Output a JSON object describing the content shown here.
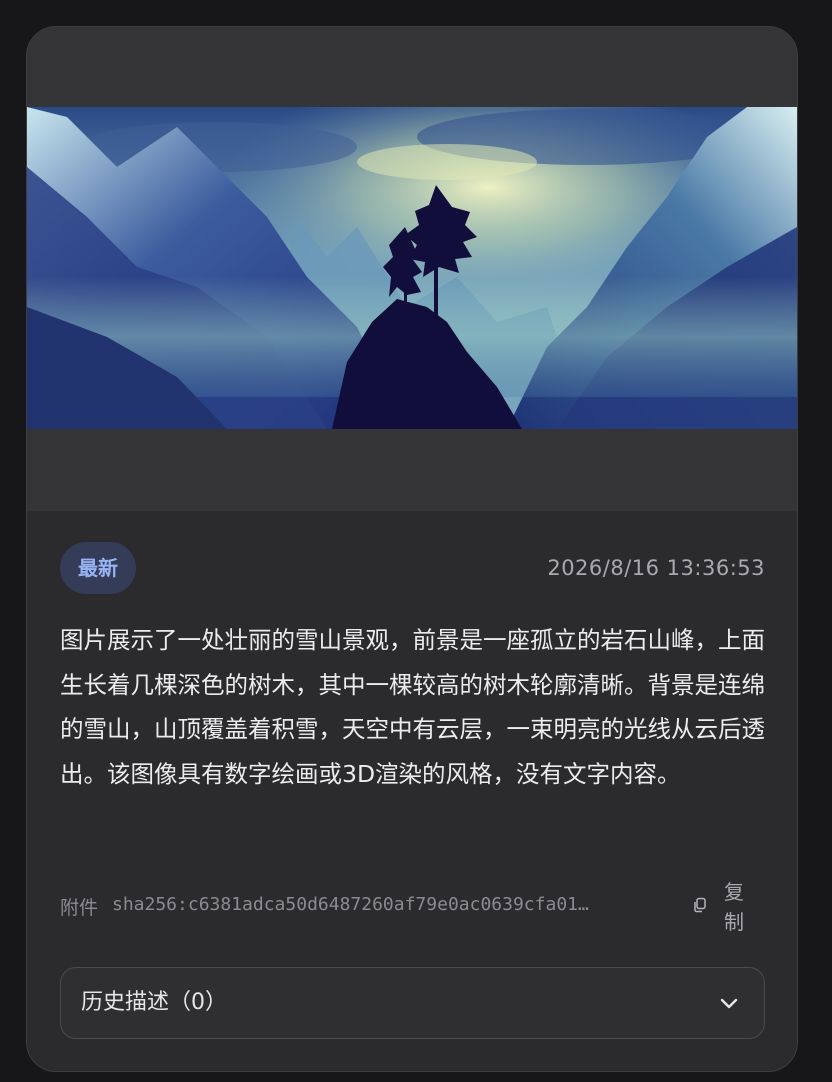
{
  "card": {
    "badge_label": "最新",
    "timestamp": "2026/8/16 13:36:53",
    "description": "图片展示了一处壮丽的雪山景观，前景是一座孤立的岩石山峰，上面生长着几棵深色的树木，其中一棵较高的树木轮廓清晰。背景是连绵的雪山，山顶覆盖着积雪，天空中有云层，一束明亮的光线从云后透出。该图像具有数字绘画或3D渲染的风格，没有文字内容。",
    "attachment": {
      "label": "附件",
      "hash": "sha256:c6381adca50d6487260af79e0ac0639cfa01…",
      "copy_label": "复制",
      "copy_icon": "copy-icon"
    },
    "history": {
      "title": "历史描述（0）",
      "icon": "chevron-down-icon"
    }
  },
  "colors": {
    "page_background": "#171719",
    "card_background": "#2b2b2e",
    "badge_background": "#353c58",
    "badge_text": "#98b4f5"
  }
}
